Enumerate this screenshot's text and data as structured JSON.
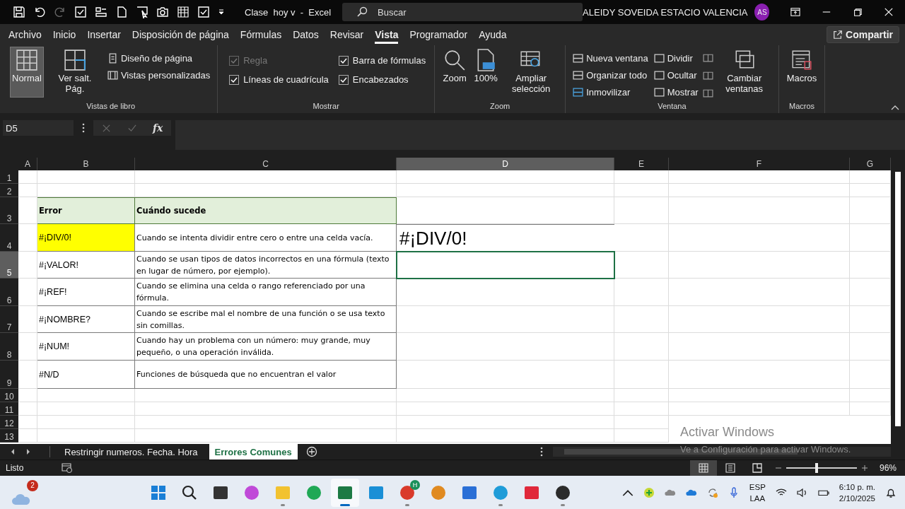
{
  "title_bar": {
    "title": "Clase  hoy v  -  Excel",
    "search": {
      "placeholder": "Buscar"
    },
    "user": "ALEIDY SOVEIDA ESTACIO VALENCIA",
    "avatar": "AS"
  },
  "menu_tabs": [
    {
      "label": "Archivo",
      "selected": false
    },
    {
      "label": "Inicio",
      "selected": false
    },
    {
      "label": "Insertar",
      "selected": false
    },
    {
      "label": "Disposición de página",
      "selected": false
    },
    {
      "label": "Fórmulas",
      "selected": false
    },
    {
      "label": "Datos",
      "selected": false
    },
    {
      "label": "Revisar",
      "selected": false
    },
    {
      "label": "Vista",
      "selected": true
    },
    {
      "label": "Programador",
      "selected": false
    },
    {
      "label": "Ayuda",
      "selected": false
    }
  ],
  "share_button": "Compartir",
  "ribbon": {
    "workbook_views": {
      "label": "Vistas de libro",
      "large": [
        {
          "label": "Normal",
          "selected": true
        },
        {
          "label": "Ver salt. Pág.",
          "selected": false
        }
      ],
      "small": [
        "Diseño de página",
        "Vistas personalizadas"
      ]
    },
    "show": {
      "label": "Mostrar",
      "checkboxes": [
        {
          "label": "Regla",
          "checked": true,
          "disabled": true
        },
        {
          "label": "Barra de fórmulas",
          "checked": true,
          "disabled": false
        },
        {
          "label": "Líneas de cuadrícula",
          "checked": true,
          "disabled": false
        },
        {
          "label": "Encabezados",
          "checked": true,
          "disabled": false
        }
      ]
    },
    "zoom": {
      "label": "Zoom",
      "buttons": [
        "Zoom",
        "100%",
        "Ampliar selección"
      ]
    },
    "window": {
      "label": "Ventana",
      "small": [
        "Nueva ventana",
        "Organizar todo",
        "Inmovilizar",
        "Dividir",
        "Ocultar",
        "Mostrar"
      ],
      "switch": "Cambiar ventanas"
    },
    "macros": {
      "label": "Macros",
      "button": "Macros"
    }
  },
  "formula_bar": {
    "name_box": "D5",
    "fx": "fx"
  },
  "sheet": {
    "columns": [
      {
        "label": "A",
        "selected": false
      },
      {
        "label": "B",
        "selected": false
      },
      {
        "label": "C",
        "selected": false
      },
      {
        "label": "D",
        "selected": true
      },
      {
        "label": "E",
        "selected": false
      },
      {
        "label": "F",
        "selected": false
      },
      {
        "label": "G",
        "selected": false
      }
    ],
    "rows": [
      {
        "label": "1",
        "selected": false
      },
      {
        "label": "2",
        "selected": false
      },
      {
        "label": "3",
        "selected": false
      },
      {
        "label": "4",
        "selected": false
      },
      {
        "label": "5",
        "selected": true
      },
      {
        "label": "6",
        "selected": false
      },
      {
        "label": "7",
        "selected": false
      },
      {
        "label": "8",
        "selected": false
      },
      {
        "label": "9",
        "selected": false
      },
      {
        "label": "10",
        "selected": false
      },
      {
        "label": "11",
        "selected": false
      },
      {
        "label": "12",
        "selected": false
      },
      {
        "label": "13",
        "selected": false
      }
    ],
    "table": {
      "header": [
        "Error",
        "Cuándo sucede"
      ],
      "rows": [
        {
          "error": "#¡DIV/0!",
          "highlight": true,
          "description": "Cuando se intenta dividir entre cero o entre una celda vacía."
        },
        {
          "error": "#¡VALOR!",
          "highlight": false,
          "description": "Cuando se usan tipos de datos incorrectos en una fórmula (texto en lugar de número, por ejemplo)."
        },
        {
          "error": "#¡REF!",
          "highlight": false,
          "description": "Cuando se elimina una celda o rango referenciado por una fórmula."
        },
        {
          "error": "#¡NOMBRE?",
          "highlight": false,
          "description": "Cuando se escribe mal el nombre de una función o se usa texto sin comillas."
        },
        {
          "error": "#¡NUM!",
          "highlight": false,
          "description": "Cuando hay un problema con un número: muy grande, muy pequeño, o una operación inválida."
        },
        {
          "error": "#N/D",
          "highlight": false,
          "description": "Funciones de búsqueda que no encuentran el valor"
        }
      ]
    },
    "result_cell": "#¡DIV/0!"
  },
  "activation_notice": {
    "title": "Activar Windows",
    "text": "Ve a Configuración para activar Windows."
  },
  "sheet_tabs": [
    {
      "label": "Restringir numeros. Fecha. Hora",
      "selected": false
    },
    {
      "label": "Errores Comunes",
      "selected": true
    }
  ],
  "status_bar": {
    "status": "Listo",
    "zoom_slider": {
      "level": 0.43
    },
    "zoom": "96%"
  },
  "taskbar": {
    "weather_badge": "2",
    "apps": [
      {
        "kind": "start",
        "running": false,
        "selected": false
      },
      {
        "kind": "search",
        "running": false,
        "selected": false
      },
      {
        "kind": "taskview",
        "running": false,
        "selected": false
      },
      {
        "kind": "copilot",
        "running": false,
        "selected": false
      },
      {
        "kind": "folder",
        "running": true,
        "selected": false
      },
      {
        "kind": "whatsapp",
        "running": false,
        "selected": false
      },
      {
        "kind": "excel",
        "running": true,
        "selected": true
      },
      {
        "kind": "monitor",
        "running": false,
        "selected": false
      },
      {
        "kind": "chrome",
        "running": true,
        "selected": false,
        "badge": "H"
      },
      {
        "kind": "keys",
        "running": false,
        "selected": false
      },
      {
        "kind": "store",
        "running": false,
        "selected": false
      },
      {
        "kind": "edge",
        "running": true,
        "selected": false
      },
      {
        "kind": "wps",
        "running": false,
        "selected": false
      },
      {
        "kind": "obs",
        "running": true,
        "selected": false
      }
    ],
    "language": [
      "ESP",
      "LAA"
    ],
    "time": "6:10 p. m.",
    "date": "2/10/2025"
  }
}
